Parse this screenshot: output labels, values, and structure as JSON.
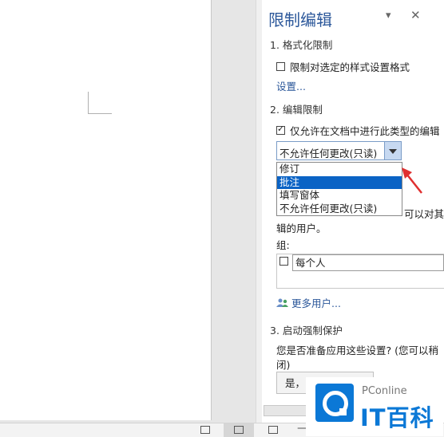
{
  "pane": {
    "title": "限制编辑",
    "pin_icon": "▾",
    "close_icon": "✕",
    "section1": {
      "heading": "1. 格式化限制",
      "checkbox_label": "限制对选定的样式设置格式",
      "checked": false,
      "settings_link": "设置..."
    },
    "section2": {
      "heading": "2. 编辑限制",
      "checkbox_label": "仅允许在文档中进行此类型的编辑",
      "checked": true,
      "combo_value": "不允许任何更改(只读)",
      "dropdown_options": [
        "修订",
        "批注",
        "填写窗体",
        "不允许任何更改(只读)"
      ],
      "selected_option": "批注",
      "partial_text_right": "可以对其",
      "partial_text_line2": "辑的用户。",
      "group_label": "组:",
      "group_entry": "每个人",
      "more_users_link": "更多用户..."
    },
    "section3": {
      "heading": "3. 启动强制保护",
      "question_line1": "您是否准备应用这些设置? (您可以稍",
      "question_line2": "闭)",
      "apply_button": "是，"
    }
  },
  "watermark": {
    "small": "PConline",
    "big": "IT百科"
  },
  "colors": {
    "accent": "#2b579a",
    "selection": "#0a63c5",
    "arrow": "#e03030",
    "watermark_blue": "#0b78d6"
  }
}
